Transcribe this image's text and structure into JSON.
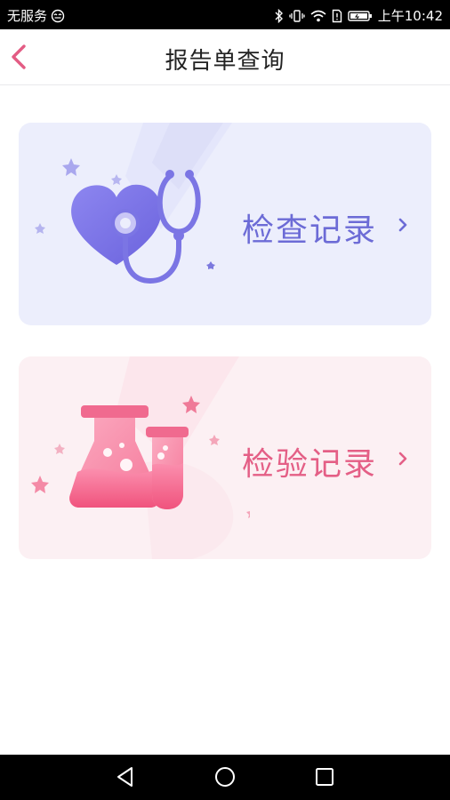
{
  "statusbar": {
    "carrier": "无服务",
    "time": "上午10:42",
    "icons": [
      "emoji-icon",
      "bluetooth-icon",
      "vibrate-icon",
      "wifi-icon",
      "sim-icon",
      "battery-icon"
    ]
  },
  "header": {
    "title": "报告单查询",
    "back_icon": "chevron-left-icon"
  },
  "cards": [
    {
      "label": "检查记录",
      "icon": "stethoscope-heart-icon",
      "arrow": "chevron-right-icon",
      "accent": "#6c6bd6",
      "background": "#eceefc"
    },
    {
      "label": "检验记录",
      "icon": "lab-flask-icon",
      "arrow": "chevron-right-icon",
      "accent": "#e45f86",
      "background": "#fcf0f3"
    }
  ],
  "navbar": {
    "icons": [
      "back-triangle-icon",
      "home-circle-icon",
      "recents-square-icon"
    ]
  },
  "colors": {
    "brand_back": "#e35c84",
    "statusbar_bg": "#000000"
  }
}
